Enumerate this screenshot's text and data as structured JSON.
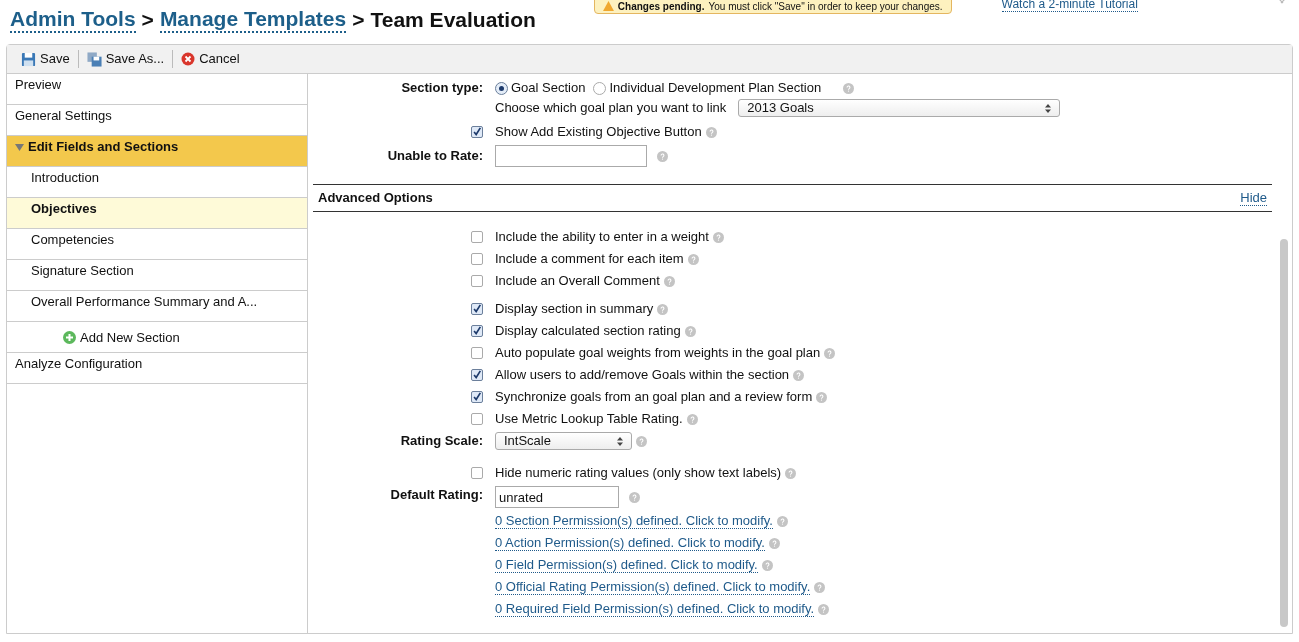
{
  "breadcrumb": [
    {
      "label": "Admin Tools",
      "link": true
    },
    {
      "label": "Manage Templates",
      "link": true
    },
    {
      "label": "Team Evaluation",
      "link": false
    }
  ],
  "separator": ">",
  "notice": {
    "title": "Changes pending.",
    "message": "You must click \"Save\" in order to keep your changes."
  },
  "tutorial_link": "Watch a 2-minute Tutorial",
  "toolbar": [
    {
      "label": "Save",
      "kind": "save"
    },
    {
      "label": "Save As...",
      "kind": "save_as"
    },
    {
      "label": "Cancel",
      "kind": "cancel"
    }
  ],
  "sidebar": {
    "items": [
      {
        "label": "Preview",
        "selected": false
      },
      {
        "label": "General Settings",
        "selected": false
      },
      {
        "label": "Edit Fields and Sections",
        "selected": true,
        "expanded": true,
        "children": [
          {
            "label": "Introduction",
            "selected": false
          },
          {
            "label": "Objectives",
            "selected": true
          },
          {
            "label": "Competencies",
            "selected": false
          },
          {
            "label": "Signature Section",
            "selected": false
          },
          {
            "label": "Overall Performance Summary and A...",
            "selected": false
          }
        ],
        "add_label": "Add New Section"
      },
      {
        "label": "Analyze Configuration",
        "selected": false
      }
    ]
  },
  "section_type": {
    "label": "Section type:",
    "options": [
      {
        "label": "Goal Section",
        "selected": true
      },
      {
        "label": "Individual Development Plan Section",
        "selected": false
      }
    ]
  },
  "goal_plan": {
    "label": "Choose which goal plan you want to link",
    "value": "2013 Goals"
  },
  "show_add_existing": {
    "label": "Show Add Existing Objective Button",
    "checked": true
  },
  "unable_to_rate": {
    "label": "Unable to Rate:"
  },
  "advanced": {
    "title": "Advanced Options",
    "toggle": "Hide",
    "groups": [
      [
        {
          "label": "Include the ability to enter in a weight",
          "checked": false
        },
        {
          "label": "Include a comment for each item",
          "checked": false
        },
        {
          "label": "Include an Overall Comment",
          "checked": false
        }
      ],
      [
        {
          "label": "Display section in summary",
          "checked": true
        },
        {
          "label": "Display calculated section rating",
          "checked": true
        },
        {
          "label": "Auto populate goal weights from weights in the goal plan",
          "checked": false
        },
        {
          "label": "Allow users to add/remove Goals within the section",
          "checked": true
        },
        {
          "label": "Synchronize goals from an goal plan and a review form",
          "checked": true
        },
        {
          "label": "Use Metric Lookup Table Rating.",
          "checked": false
        }
      ]
    ],
    "rating_scale": {
      "label": "Rating Scale:",
      "value": "IntScale"
    },
    "hide_numeric": {
      "label": "Hide numeric rating values (only show text labels)",
      "checked": false
    },
    "default_rating": {
      "label": "Default Rating:",
      "value": "unrated"
    },
    "permission_links": [
      "0 Section Permission(s) defined. Click to modify.",
      "0 Action Permission(s) defined. Click to modify.",
      "0 Field Permission(s) defined. Click to modify.",
      "0 Official Rating Permission(s) defined. Click to modify.",
      "0 Required Field Permission(s) defined. Click to modify."
    ]
  }
}
